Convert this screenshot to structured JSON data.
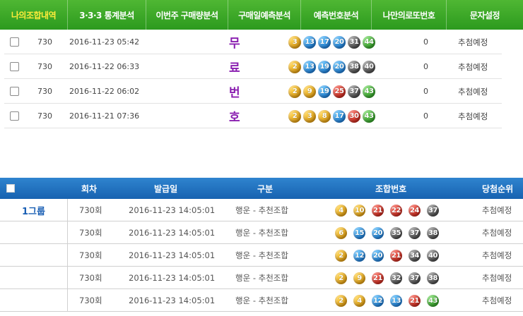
{
  "nav": {
    "items": [
      {
        "label": "나의조합내역",
        "active": true
      },
      {
        "label": "3·3·3 통계분석"
      },
      {
        "label": "이번주 구매량분석"
      },
      {
        "label": "구매일예측분석"
      },
      {
        "label": "예측번호분석"
      },
      {
        "label": "나만의로또번호"
      },
      {
        "label": "문자설정"
      }
    ]
  },
  "colors": {
    "nav_bg": "#3aa826",
    "nav_active": "#ffec3b",
    "header_bg": "#1f6fbf",
    "free_text": "#8a1fb0",
    "group_text": "#1a5fb4"
  },
  "free_label_chars": [
    "무",
    "료",
    "번",
    "호"
  ],
  "top_rows": [
    {
      "round": "730",
      "date": "2016-11-23 05:42",
      "balls": [
        3,
        13,
        17,
        20,
        31,
        44
      ],
      "count": "0",
      "status": "추첨예정"
    },
    {
      "round": "730",
      "date": "2016-11-22 06:33",
      "balls": [
        2,
        13,
        19,
        20,
        38,
        40
      ],
      "count": "0",
      "status": "추첨예정"
    },
    {
      "round": "730",
      "date": "2016-11-22 06:02",
      "balls": [
        2,
        9,
        19,
        25,
        37,
        43
      ],
      "count": "0",
      "status": "추첨예정"
    },
    {
      "round": "730",
      "date": "2016-11-21 07:36",
      "balls": [
        2,
        3,
        8,
        17,
        30,
        43
      ],
      "count": "0",
      "status": "추첨예정"
    }
  ],
  "bottom_table": {
    "headers": {
      "round": "회차",
      "date": "발급일",
      "type": "구분",
      "numbers": "조합번호",
      "rank": "당첨순위"
    },
    "group_label": "1그룹",
    "rows": [
      {
        "round": "730회",
        "date": "2016-11-23 14:05:01",
        "type": "행운 - 추천조합",
        "balls": [
          4,
          10,
          21,
          22,
          24,
          37
        ],
        "rank": "추첨예정"
      },
      {
        "round": "730회",
        "date": "2016-11-23 14:05:01",
        "type": "행운 - 추천조합",
        "balls": [
          6,
          15,
          20,
          35,
          37,
          38
        ],
        "rank": "추첨예정"
      },
      {
        "round": "730회",
        "date": "2016-11-23 14:05:01",
        "type": "행운 - 추천조합",
        "balls": [
          2,
          12,
          20,
          21,
          34,
          40
        ],
        "rank": "추첨예정"
      },
      {
        "round": "730회",
        "date": "2016-11-23 14:05:01",
        "type": "행운 - 추천조합",
        "balls": [
          2,
          9,
          21,
          32,
          37,
          38
        ],
        "rank": "추첨예정"
      },
      {
        "round": "730회",
        "date": "2016-11-23 14:05:01",
        "type": "행운 - 추천조합",
        "balls": [
          2,
          4,
          12,
          13,
          21,
          43
        ],
        "rank": "추첨예정"
      }
    ]
  }
}
